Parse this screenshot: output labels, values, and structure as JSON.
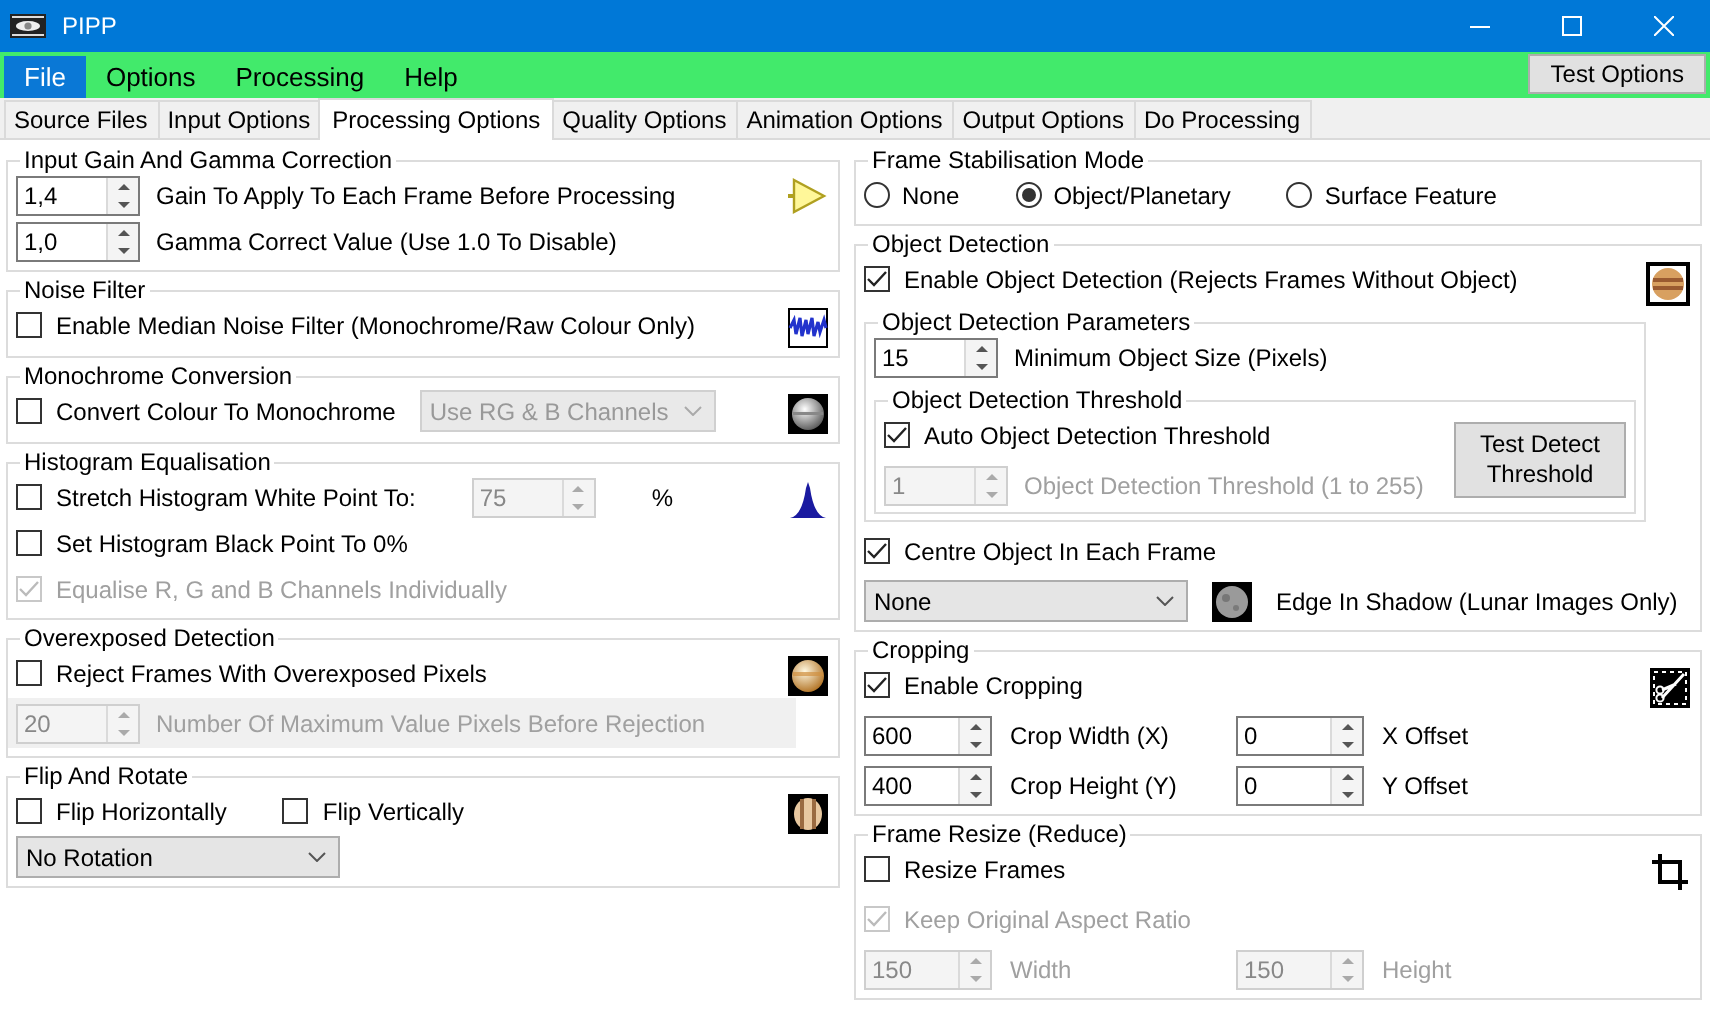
{
  "window": {
    "title": "PIPP"
  },
  "menu": [
    {
      "label": "File",
      "selected": true
    },
    {
      "label": "Options",
      "selected": false
    },
    {
      "label": "Processing",
      "selected": false
    },
    {
      "label": "Help",
      "selected": false
    }
  ],
  "test_options_button": "Test Options",
  "tabs": [
    {
      "label": "Source Files",
      "selected": false
    },
    {
      "label": "Input Options",
      "selected": false
    },
    {
      "label": "Processing Options",
      "selected": true
    },
    {
      "label": "Quality Options",
      "selected": false
    },
    {
      "label": "Animation Options",
      "selected": false
    },
    {
      "label": "Output Options",
      "selected": false
    },
    {
      "label": "Do Processing",
      "selected": false
    }
  ],
  "left_column": [
    {
      "title": "Input Gain And Gamma Correction",
      "rows": [
        {
          "items": [
            {
              "kind": "spin",
              "value": "1,4",
              "disabled": false,
              "label": "Gain To Apply To Each Frame Before Processing"
            }
          ]
        },
        {
          "items": [
            {
              "kind": "spin",
              "value": "1,0",
              "disabled": false,
              "label": "Gamma Correct Value (Use 1.0 To Disable)"
            }
          ]
        }
      ]
    },
    {
      "title": "Noise Filter",
      "rows": [
        {
          "items": [
            {
              "kind": "check",
              "label": "Enable Median Noise Filter (Monochrome/Raw Colour Only)",
              "checked": false,
              "disabled": false
            }
          ]
        }
      ]
    },
    {
      "title": "Monochrome Conversion",
      "rows": [
        {
          "items": [
            {
              "kind": "check",
              "label": "Convert Colour To Monochrome",
              "checked": false,
              "disabled": false
            },
            {
              "kind": "select",
              "value": "Use RG & B Channels",
              "disabled": true
            }
          ]
        }
      ]
    },
    {
      "title": "Histogram Equalisation",
      "rows": [
        {
          "items": [
            {
              "kind": "check",
              "label": "Stretch Histogram White Point To:",
              "checked": false,
              "disabled": false
            },
            {
              "kind": "spin",
              "value": "75",
              "disabled": true
            },
            {
              "kind": "text",
              "label": "%"
            }
          ]
        },
        {
          "items": [
            {
              "kind": "check",
              "label": "Set Histogram Black Point To 0%",
              "checked": false,
              "disabled": false
            }
          ]
        },
        {
          "items": [
            {
              "kind": "check",
              "label": "Equalise R, G and B Channels Individually",
              "checked": true,
              "disabled": true
            }
          ]
        }
      ]
    },
    {
      "title": "Overexposed Detection",
      "rows": [
        {
          "items": [
            {
              "kind": "check",
              "label": "Reject Frames With Overexposed Pixels",
              "checked": false,
              "disabled": false
            }
          ]
        },
        {
          "disabled": true,
          "items": [
            {
              "kind": "spin",
              "value": "20",
              "disabled": true,
              "label": "Number Of Maximum Value Pixels Before Rejection"
            }
          ]
        }
      ]
    },
    {
      "title": "Flip And Rotate",
      "rows": [
        {
          "items": [
            {
              "kind": "check",
              "label": "Flip Horizontally",
              "checked": false,
              "disabled": false
            },
            {
              "kind": "check",
              "label": "Flip Vertically",
              "checked": false,
              "disabled": false
            }
          ]
        },
        {
          "items": [
            {
              "kind": "select",
              "value": "No Rotation",
              "disabled": false
            }
          ]
        }
      ]
    }
  ],
  "right_column": [
    {
      "title": "Frame Stabilisation Mode",
      "rows": [
        {
          "items": [
            {
              "kind": "radio",
              "label": "None",
              "selected": false
            },
            {
              "kind": "radio",
              "label": "Object/Planetary",
              "selected": true
            },
            {
              "kind": "radio",
              "label": "Surface Feature",
              "selected": false
            }
          ]
        }
      ]
    },
    {
      "title": "Object Detection",
      "rows": [
        {
          "items": [
            {
              "kind": "check",
              "label": "Enable Object Detection (Rejects Frames Without Object)",
              "checked": true,
              "disabled": false
            }
          ]
        },
        {
          "items": [
            {
              "kind": "group",
              "title": "Object Detection Parameters",
              "rows": [
                {
                  "items": [
                    {
                      "kind": "spin",
                      "value": "15",
                      "disabled": false,
                      "label": "Minimum Object Size (Pixels)"
                    }
                  ]
                },
                {
                  "items": [
                    {
                      "kind": "group",
                      "title": "Object Detection Threshold",
                      "side_button": {
                        "label": "Test Detect Threshold"
                      },
                      "rows": [
                        {
                          "items": [
                            {
                              "kind": "check",
                              "label": "Auto Object Detection Threshold",
                              "checked": true,
                              "disabled": false
                            }
                          ]
                        },
                        {
                          "items": [
                            {
                              "kind": "spin",
                              "value": "1",
                              "disabled": true,
                              "label": "Object Detection Threshold (1 to 255)"
                            }
                          ]
                        }
                      ]
                    }
                  ]
                }
              ]
            }
          ]
        },
        {
          "items": [
            {
              "kind": "check",
              "label": "Centre Object In Each Frame",
              "checked": true,
              "disabled": false
            }
          ]
        },
        {
          "items": [
            {
              "kind": "select",
              "value": "None",
              "disabled": false
            },
            {
              "kind": "icon"
            },
            {
              "kind": "text",
              "label": "Edge In Shadow (Lunar Images Only)"
            }
          ]
        }
      ]
    },
    {
      "title": "Cropping",
      "rows": [
        {
          "items": [
            {
              "kind": "check",
              "label": "Enable Cropping",
              "checked": true,
              "disabled": false
            }
          ]
        },
        {
          "items": [
            {
              "kind": "spin",
              "value": "600",
              "disabled": false
            },
            {
              "kind": "text",
              "label": "Crop Width (X)"
            },
            {
              "kind": "spin",
              "value": "0",
              "disabled": false
            },
            {
              "kind": "text",
              "label": "X Offset"
            }
          ]
        },
        {
          "items": [
            {
              "kind": "spin",
              "value": "400",
              "disabled": false
            },
            {
              "kind": "text",
              "label": "Crop Height (Y)"
            },
            {
              "kind": "spin",
              "value": "0",
              "disabled": false
            },
            {
              "kind": "text",
              "label": "Y Offset"
            }
          ]
        }
      ]
    },
    {
      "title": "Frame Resize (Reduce)",
      "rows": [
        {
          "items": [
            {
              "kind": "check",
              "label": "Resize Frames",
              "checked": false,
              "disabled": false
            }
          ]
        },
        {
          "items": [
            {
              "kind": "check",
              "label": "Keep Original Aspect Ratio",
              "checked": true,
              "disabled": true
            }
          ]
        },
        {
          "items": [
            {
              "kind": "spin",
              "value": "150",
              "disabled": true
            },
            {
              "kind": "text",
              "label": "Width",
              "disabled": true
            },
            {
              "kind": "spin",
              "value": "150",
              "disabled": true
            },
            {
              "kind": "text",
              "label": "Height",
              "disabled": true
            }
          ]
        }
      ]
    }
  ]
}
